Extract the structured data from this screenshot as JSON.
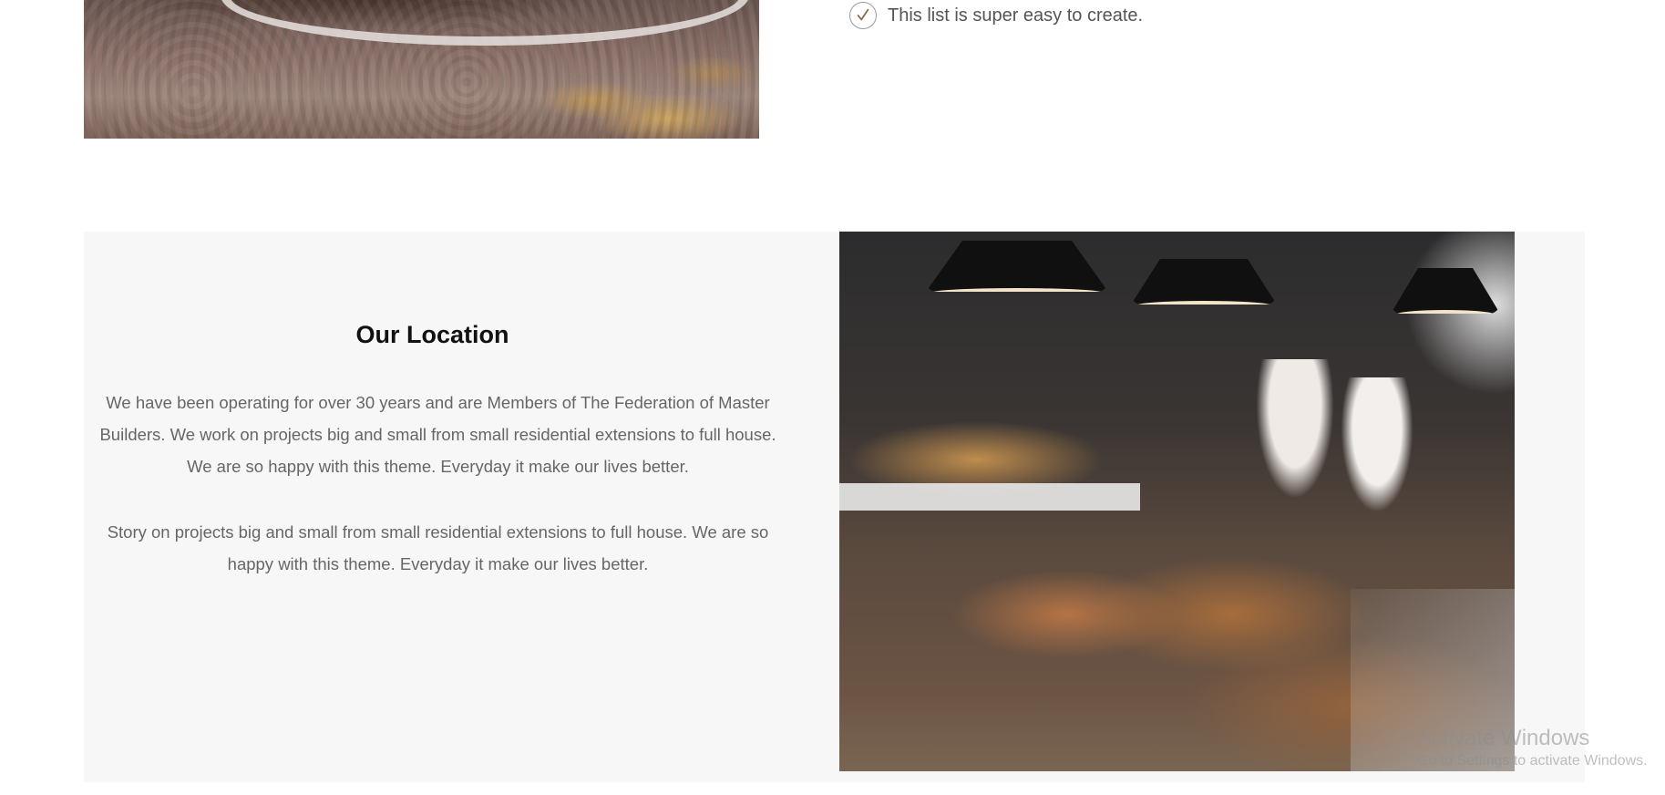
{
  "checklist": {
    "items": [
      {
        "text": "This list is super easy to create.",
        "icon": "checkmark-icon"
      }
    ]
  },
  "location": {
    "title": "Our Location",
    "paragraphs": [
      "We have been operating for over 30 years and are Members of The Federation of Master Builders. We work on projects big and small from small residential extensions to full house. We are so happy with this theme. Everyday it make our lives better.",
      "Story on projects big and small from small residential extensions to full house. We are so happy with this theme. Everyday it make our lives better."
    ]
  },
  "watermark": {
    "title": "Activate Windows",
    "subtitle": "Go to Settings to activate Windows."
  },
  "colors": {
    "section_background": "#f7f7f7",
    "body_text": "#666666",
    "heading_text": "#111111"
  }
}
